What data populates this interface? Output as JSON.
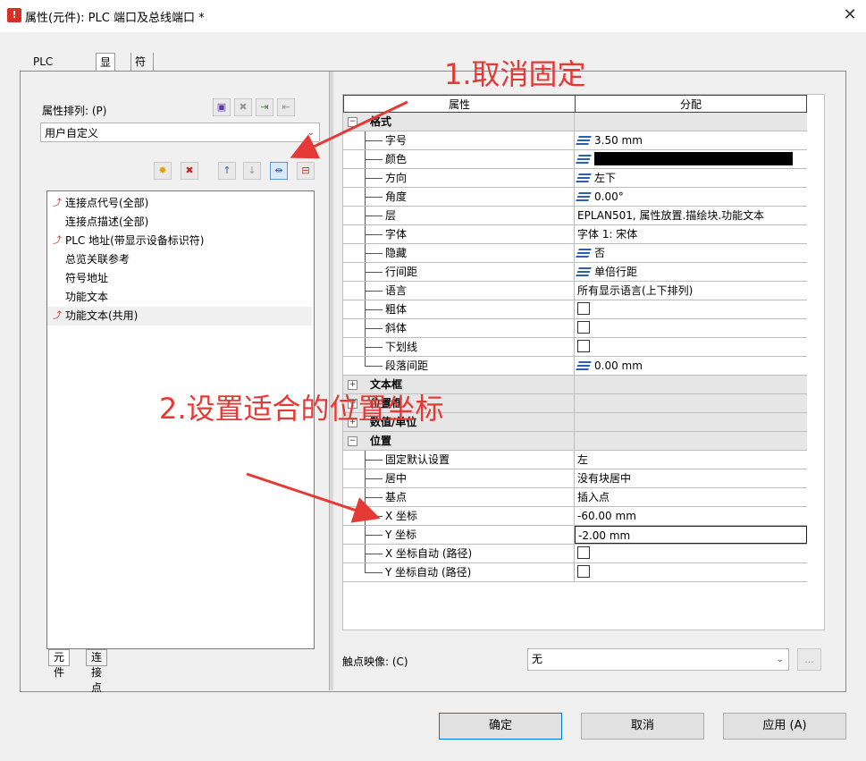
{
  "window": {
    "title": "属性(元件): PLC 端口及总线端口 *"
  },
  "tabs_top": [
    {
      "label": "PLC 连接点"
    },
    {
      "label": "显示"
    },
    {
      "label": "符号数据/功能数据"
    }
  ],
  "left": {
    "sort_label": "属性排列: (P)",
    "sort_value": "用户自定义",
    "items": [
      {
        "label": "连接点代号(全部)",
        "icon": "arrow-red-icon"
      },
      {
        "label": "连接点描述(全部)",
        "icon": ""
      },
      {
        "label": "PLC 地址(带显示设备标识符)",
        "icon": "arrow-red-icon"
      },
      {
        "label": "总览关联参考",
        "icon": ""
      },
      {
        "label": "符号地址",
        "icon": ""
      },
      {
        "label": "功能文本",
        "icon": ""
      },
      {
        "label": "功能文本(共用)",
        "icon": "arrow-red-icon"
      }
    ],
    "bottom_tabs": [
      {
        "label": "元件"
      },
      {
        "label": "连接点"
      }
    ]
  },
  "grid": {
    "headers": {
      "property": "属性",
      "value": "分配"
    },
    "rows": [
      {
        "name": "格式",
        "type": "group",
        "value": ""
      },
      {
        "name": "字号",
        "type": "prop",
        "value": "3.50 mm",
        "icon": true
      },
      {
        "name": "颜色",
        "type": "prop",
        "value": "",
        "icon": true,
        "black": true
      },
      {
        "name": "方向",
        "type": "prop",
        "value": "左下",
        "icon": true
      },
      {
        "name": "角度",
        "type": "prop",
        "value": "0.00°",
        "icon": true
      },
      {
        "name": "层",
        "type": "prop",
        "value": "EPLAN501, 属性放置.描绘块.功能文本"
      },
      {
        "name": "字体",
        "type": "prop",
        "value": "字体 1: 宋体"
      },
      {
        "name": "隐藏",
        "type": "prop",
        "value": "否",
        "icon": true
      },
      {
        "name": "行间距",
        "type": "prop",
        "value": "单倍行距",
        "icon": true
      },
      {
        "name": "语言",
        "type": "prop",
        "value": "所有显示语言(上下排列)"
      },
      {
        "name": "粗体",
        "type": "prop",
        "value": "",
        "check": true
      },
      {
        "name": "斜体",
        "type": "prop",
        "value": "",
        "check": true
      },
      {
        "name": "下划线",
        "type": "prop",
        "value": "",
        "check": true
      },
      {
        "name": "段落间距",
        "type": "prop",
        "value": "0.00 mm",
        "icon": true,
        "last": true
      },
      {
        "name": "文本框",
        "type": "group",
        "value": ""
      },
      {
        "name": "位置框",
        "type": "group",
        "value": ""
      },
      {
        "name": "数值/单位",
        "type": "group",
        "value": ""
      },
      {
        "name": "位置",
        "type": "group",
        "value": ""
      },
      {
        "name": "固定默认设置",
        "type": "prop",
        "value": "左"
      },
      {
        "name": "居中",
        "type": "prop",
        "value": "没有块居中"
      },
      {
        "name": "基点",
        "type": "prop",
        "value": "插入点"
      },
      {
        "name": "X 坐标",
        "type": "prop",
        "value": "-60.00 mm"
      },
      {
        "name": "Y 坐标",
        "type": "prop",
        "value": "-2.00 mm",
        "editing": true
      },
      {
        "name": "X 坐标自动 (路径)",
        "type": "prop",
        "value": "",
        "check": true
      },
      {
        "name": "Y 坐标自动 (路径)",
        "type": "prop",
        "value": "",
        "check": true,
        "last": true
      }
    ]
  },
  "contact": {
    "label": "触点映像: (C)",
    "value": "无",
    "more": "..."
  },
  "buttons": {
    "ok": "确定",
    "cancel": "取消",
    "apply": "应用 (A)"
  },
  "annotations": {
    "a1": "1.取消固定",
    "a2": "2.设置适合的位置坐标"
  },
  "colors": {
    "annotation": "#e53935",
    "icon_blue": "#2b5fb4",
    "accent": "#0078d7"
  }
}
